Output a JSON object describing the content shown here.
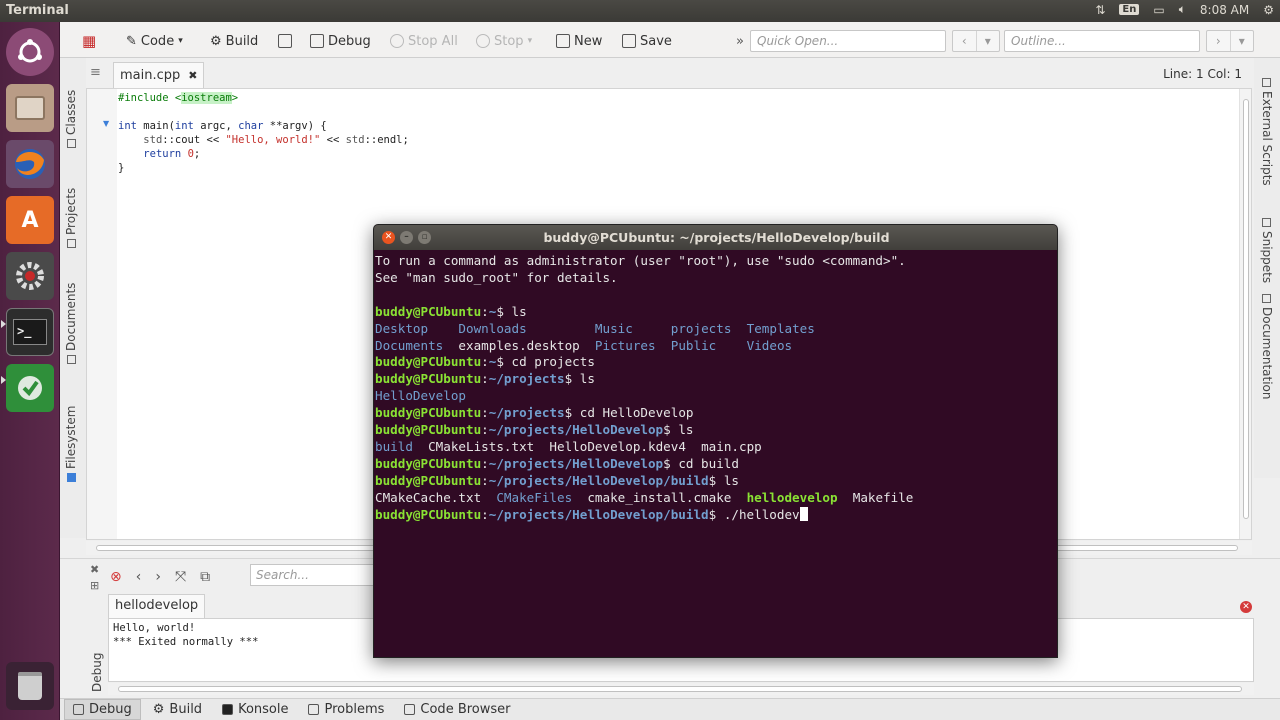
{
  "topbar": {
    "title": "Terminal",
    "keyboard": "En",
    "time": "8:08 AM"
  },
  "launcher": {
    "items": [
      "ubuntu-dash",
      "files",
      "firefox",
      "software-center",
      "system-settings",
      "terminal",
      "kdevelop"
    ],
    "trash": "trash"
  },
  "toolbar": {
    "code": "Code",
    "build": "Build",
    "debug": "Debug",
    "stop_all": "Stop All",
    "stop": "Stop",
    "new": "New",
    "save": "Save",
    "quick_open_placeholder": "Quick Open...",
    "outline_placeholder": "Outline..."
  },
  "left_dock": {
    "tabs": [
      "Classes",
      "Projects",
      "Documents",
      "Filesystem"
    ]
  },
  "right_dock": {
    "tabs": [
      "External Scripts",
      "Snippets",
      "Documentation"
    ]
  },
  "editor": {
    "file_tab": "main.cpp",
    "cursor_pos": "Line: 1 Col: 1",
    "lines": [
      "#include <iostream>",
      "",
      "int main(int argc, char **argv) {",
      "    std::cout << \"Hello, world!\" << std::endl;",
      "    return 0;",
      "}"
    ]
  },
  "bottom": {
    "search_placeholder": "Search...",
    "output_tab": "hellodevelop",
    "output_lines": [
      "Hello, world!",
      "*** Exited normally ***"
    ],
    "side_label": "Debug"
  },
  "statusbar": {
    "tabs": [
      "Debug",
      "Build",
      "Konsole",
      "Problems",
      "Code Browser"
    ]
  },
  "terminal": {
    "title": "buddy@PCUbuntu: ~/projects/HelloDevelop/build",
    "intro": [
      "To run a command as administrator (user \"root\"), use \"sudo <command>\".",
      "See \"man sudo_root\" for details."
    ],
    "user_host": "buddy@PCUbuntu",
    "sessions": [
      {
        "path": "~",
        "cmd": "ls"
      },
      {
        "path": "~",
        "cmd": "cd projects"
      },
      {
        "path": "~/projects",
        "cmd": "ls"
      },
      {
        "path": "~/projects",
        "cmd": "cd HelloDevelop"
      },
      {
        "path": "~/projects/HelloDevelop",
        "cmd": "ls"
      },
      {
        "path": "~/projects/HelloDevelop",
        "cmd": "cd build"
      },
      {
        "path": "~/projects/HelloDevelop/build",
        "cmd": "ls"
      },
      {
        "path": "~/projects/HelloDevelop/build",
        "cmd": "./hellodev"
      }
    ],
    "home_listing": [
      [
        "Desktop",
        "Downloads",
        "Music",
        "projects",
        "Templates"
      ],
      [
        "Documents",
        "examples.desktop",
        "Pictures",
        "Public",
        "Videos"
      ]
    ],
    "projects_listing": [
      "HelloDevelop"
    ],
    "hellodevelop_listing": [
      "build",
      "CMakeLists.txt",
      "HelloDevelop.kdev4",
      "main.cpp"
    ],
    "build_listing": [
      "CMakeCache.txt",
      "CMakeFiles",
      "cmake_install.cmake",
      "hellodevelop",
      "Makefile"
    ]
  },
  "colors": {
    "launcher": "#5c2a4b",
    "terminal_bg": "#300a24",
    "prompt": "#8ae234",
    "path": "#729fcf"
  }
}
